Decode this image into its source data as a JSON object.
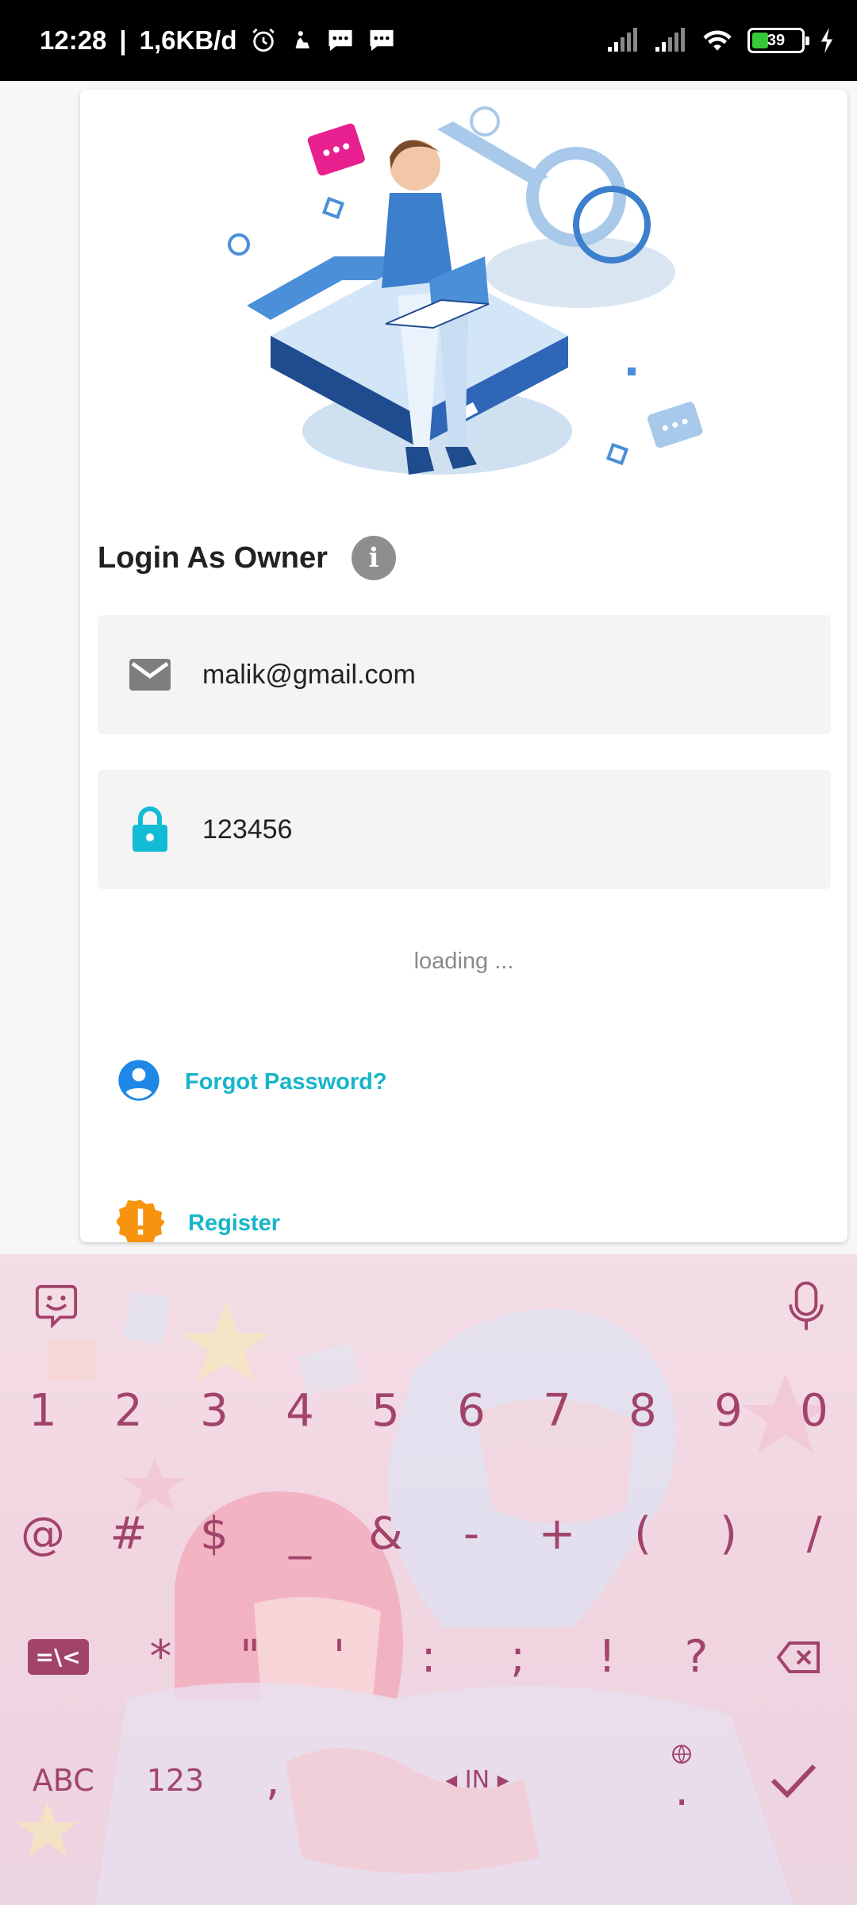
{
  "status_bar": {
    "time": "12:28",
    "separator": "|",
    "network_speed": "1,6KB/d",
    "battery_level": "39",
    "icons": [
      "alarm-icon",
      "muslim-pray-icon",
      "message-icon",
      "message-icon",
      "signal-icon",
      "signal-icon",
      "wifi-icon",
      "battery-icon",
      "charging-icon"
    ]
  },
  "login": {
    "title": "Login As Owner",
    "info_icon": "i",
    "email_value": "malik@gmail.com",
    "password_value": "123456",
    "loading_text": "loading ...",
    "forgot_label": "Forgot Password?",
    "register_label": "Register"
  },
  "colors": {
    "accent": "#17b5c9",
    "lock": "#12bcd4",
    "register_badge": "#f7930e",
    "keyboard_key": "#a2446a"
  },
  "keyboard": {
    "row_numbers": [
      "1",
      "2",
      "3",
      "4",
      "5",
      "6",
      "7",
      "8",
      "9",
      "0"
    ],
    "row_symbols": [
      "@",
      "#",
      "$",
      "_",
      "&",
      "-",
      "+",
      "(",
      ")",
      "/"
    ],
    "row_symbols2": [
      "*",
      "\"",
      "'",
      ":",
      ";",
      "!",
      "?"
    ],
    "switch_label": "=\\<",
    "abc_label": "ABC",
    "num_label": "123",
    "comma": ",",
    "lang_label": "IN",
    "period": "."
  }
}
